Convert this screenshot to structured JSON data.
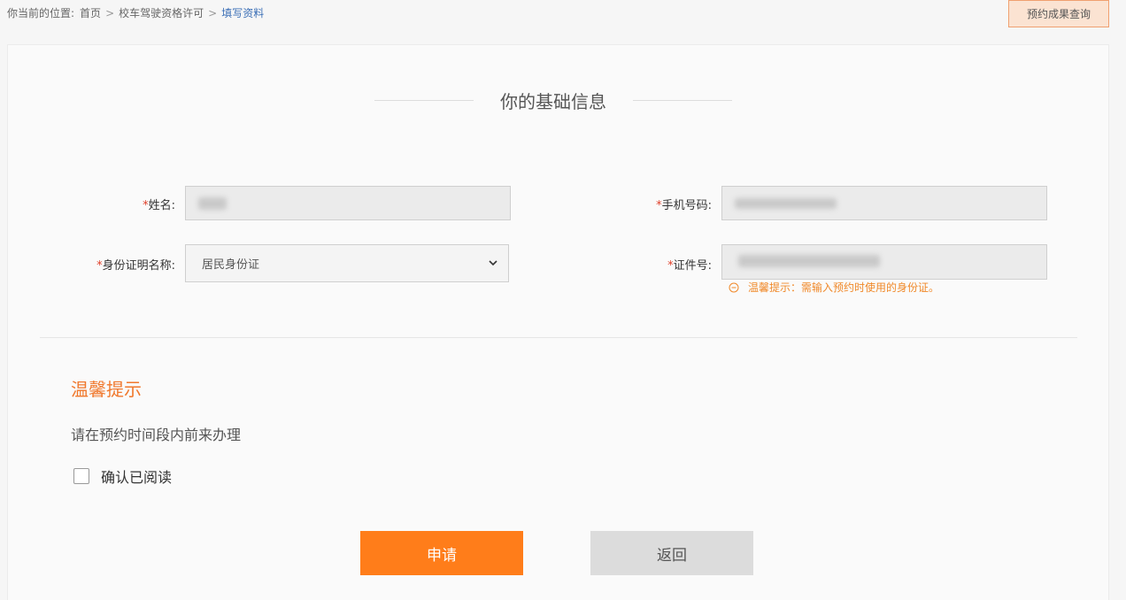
{
  "breadcrumb": {
    "prefix": "你当前的位置:",
    "items": [
      "首页",
      "校车驾驶资格许可",
      "填写资料"
    ]
  },
  "header": {
    "query_button": "预约成果查询"
  },
  "section": {
    "title": "你的基础信息"
  },
  "form": {
    "required_mark": "*",
    "name_label": "姓名:",
    "phone_label": "手机号码:",
    "id_type_label": "身份证明名称:",
    "id_type_value": "居民身份证",
    "id_number_label": "证件号:",
    "id_hint": "温馨提示：需输入预约时使用的身份证。"
  },
  "tips": {
    "title": "温馨提示",
    "text": "请在预约时间段内前来办理",
    "confirm_label": "确认已阅读"
  },
  "actions": {
    "apply": "申请",
    "back": "返回"
  },
  "colors": {
    "accent": "#ff7d1a",
    "hint": "#f0892a",
    "required": "#e0402a",
    "link": "#3b6fb6"
  }
}
